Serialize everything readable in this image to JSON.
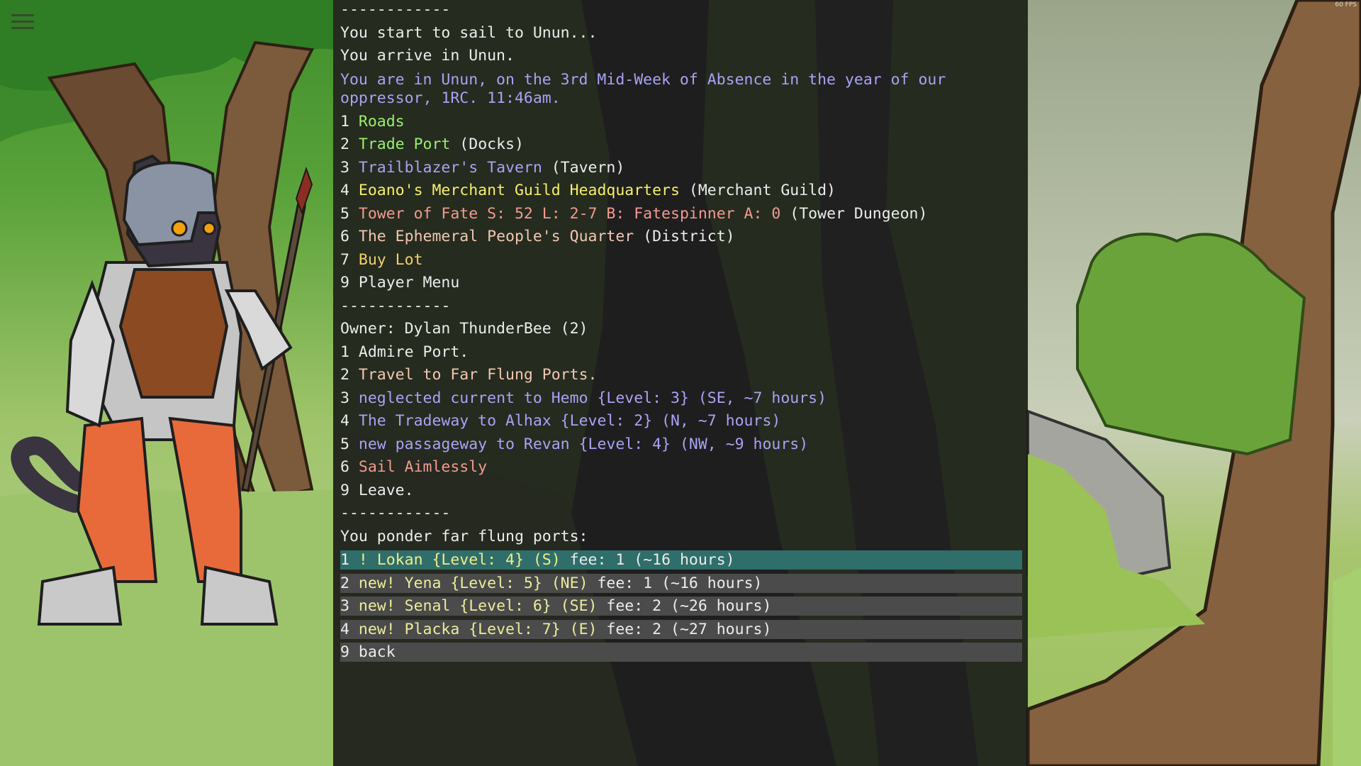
{
  "fps_text": "60 FPS",
  "menu_icon": "hamburger-menu-icon",
  "colors": {
    "console_bg": "#1a1a1a",
    "location_text": "#a9a3f5",
    "selected_row": "#2f6e6a",
    "row": "#4b4b4b"
  },
  "log": {
    "divider_top": "------------",
    "sail_start": "You start to sail to Unun...",
    "arrive": "You arrive in Unun.",
    "location": "You are in Unun, on the 3rd Mid-Week of Absence in the year of our oppressor, 1RC. 11:46am."
  },
  "town_menu": [
    {
      "num": "1",
      "name": "Roads",
      "suffix": ""
    },
    {
      "num": "2",
      "name": "Trade Port",
      "suffix": " (Docks)"
    },
    {
      "num": "3",
      "name": "Trailblazer's Tavern",
      "suffix": " (Tavern)"
    },
    {
      "num": "4",
      "name": "Eoano's Merchant Guild Headquarters",
      "suffix": " (Merchant Guild)"
    },
    {
      "num": "5",
      "name": "Tower of Fate S: 52 L: 2-7 B: Fatespinner A: 0",
      "suffix": " (Tower Dungeon)"
    },
    {
      "num": "6",
      "name": "The Ephemeral People's Quarter",
      "suffix": " (District)"
    },
    {
      "num": "7",
      "name": "Buy Lot",
      "suffix": ""
    },
    {
      "num": "9",
      "name": "Player Menu",
      "suffix": ""
    }
  ],
  "divider_mid": "------------",
  "port": {
    "owner": "Owner: Dylan ThunderBee (2)",
    "options": [
      {
        "num": "1",
        "label": "Admire Port."
      },
      {
        "num": "2",
        "label": "Travel to Far Flung Ports."
      },
      {
        "num": "3",
        "label": "neglected current to Hemo {Level: 3} (SE, ~7 hours)"
      },
      {
        "num": "4",
        "label": "The Tradeway to Alhax {Level: 2} (N, ~7 hours)"
      },
      {
        "num": "5",
        "label": "new passageway to Revan {Level: 4} (NW, ~9 hours)"
      },
      {
        "num": "6",
        "label": "Sail Aimlessly"
      },
      {
        "num": "9",
        "label": "Leave."
      }
    ]
  },
  "divider_bottom": "------------",
  "ponder": "You ponder far flung ports:",
  "far_ports": [
    {
      "num": "1",
      "label": "! Lokan {Level: 4} (S)",
      "fee": " fee: 1 (~16 hours)",
      "selected": true
    },
    {
      "num": "2",
      "label": "new! Yena {Level: 5} (NE)",
      "fee": " fee: 1 (~16 hours)",
      "selected": false
    },
    {
      "num": "3",
      "label": "new! Senal {Level: 6} (SE)",
      "fee": " fee: 2 (~26 hours)",
      "selected": false
    },
    {
      "num": "4",
      "label": "new! Placka {Level: 7} (E)",
      "fee": " fee: 2 (~27 hours)",
      "selected": false
    },
    {
      "num": "9",
      "label": "back",
      "fee": "",
      "selected": false
    }
  ]
}
